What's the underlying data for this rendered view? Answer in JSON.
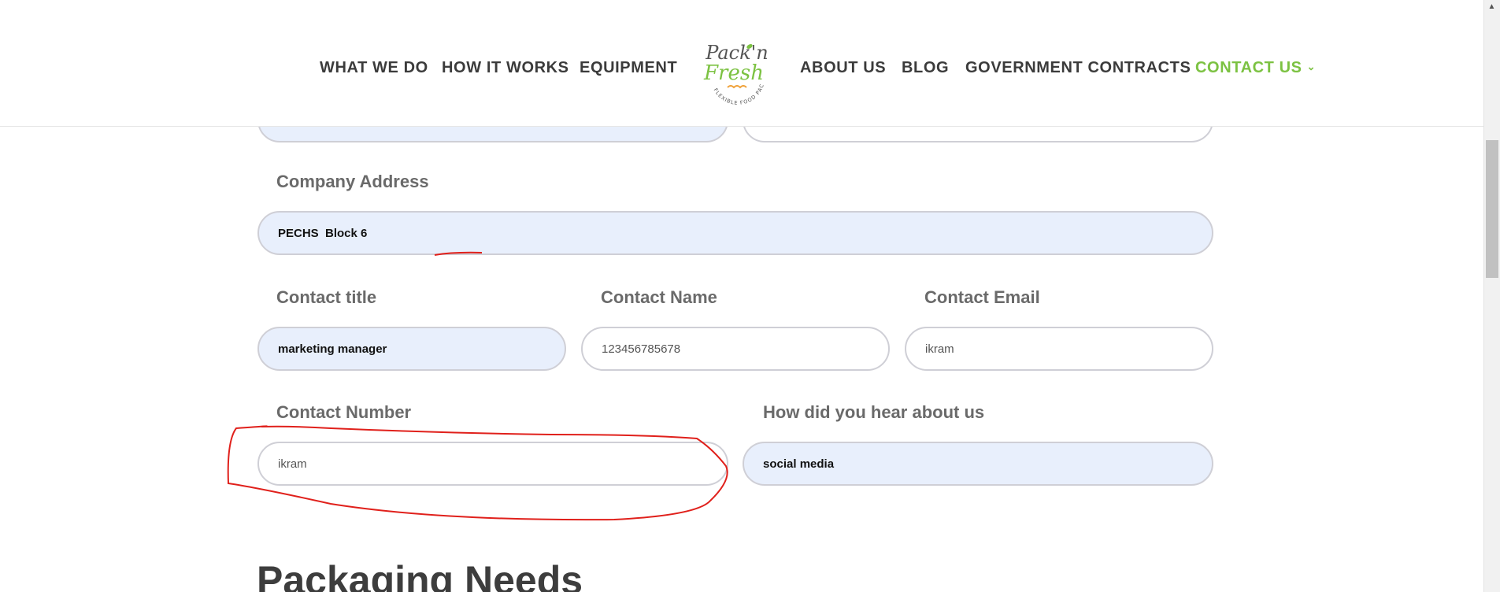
{
  "nav": {
    "left": [
      "WHAT WE DO",
      "HOW IT WORKS",
      "EQUIPMENT"
    ],
    "right": [
      "ABOUT US",
      "BLOG",
      "GOVERNMENT CONTRACTS",
      "CONTACT US"
    ],
    "active": "CONTACT US",
    "accent_color": "#7cc242"
  },
  "logo": {
    "line1": "Pack'n",
    "line2": "Fresh",
    "tagline": "FLEXIBLE FOOD PACKAGING"
  },
  "form": {
    "company_address": {
      "label": "Company Address",
      "value": "PECHS  Block 6"
    },
    "contact_title": {
      "label": "Contact title",
      "value": "marketing manager"
    },
    "contact_name": {
      "label": "Contact Name",
      "value": "123456785678"
    },
    "contact_email": {
      "label": "Contact Email",
      "value": "ikram"
    },
    "contact_number": {
      "label": "Contact Number",
      "value": "ikram"
    },
    "how_heard": {
      "label": "How did you hear about us",
      "value": "social media"
    }
  },
  "section": {
    "heading": "Packaging Needs"
  },
  "colors": {
    "autofill_bg": "#e8effc",
    "annotation": "#e0201b"
  }
}
